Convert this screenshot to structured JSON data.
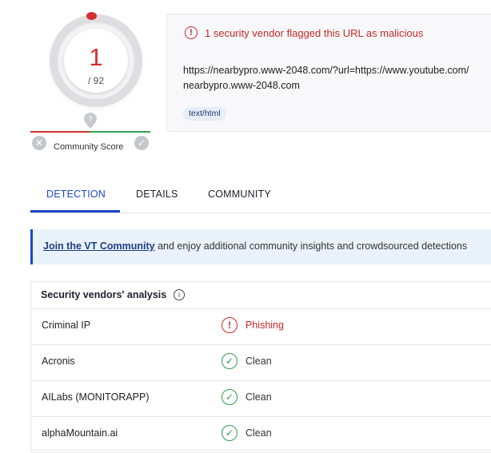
{
  "score": {
    "detections": "1",
    "total": "/ 92",
    "community_label": "Community Score"
  },
  "summary": {
    "alert": "1 security vendor flagged this URL as malicious",
    "url_full": "https://nearbypro.www-2048.com/?url=https://www.youtube.com/",
    "url_host": "nearbypro.www-2048.com",
    "tag": "text/html"
  },
  "tabs": [
    {
      "label": "DETECTION",
      "active": true
    },
    {
      "label": "DETAILS",
      "active": false
    },
    {
      "label": "COMMUNITY",
      "active": false
    }
  ],
  "banner": {
    "link": "Join the VT Community",
    "text": " and enjoy additional community insights and crowdsourced detections"
  },
  "analysis": {
    "title": "Security vendors' analysis",
    "rows": [
      {
        "vendor": "Criminal IP",
        "result": "Phishing",
        "status": "malicious"
      },
      {
        "vendor": "Acronis",
        "result": "Clean",
        "status": "clean"
      },
      {
        "vendor": "AILabs (MONITORAPP)",
        "result": "Clean",
        "status": "clean"
      },
      {
        "vendor": "alphaMountain.ai",
        "result": "Clean",
        "status": "clean"
      }
    ]
  },
  "colors": {
    "accent": "#1a47c6",
    "malicious": "#c62828",
    "clean": "#2e9d48"
  },
  "icons": {
    "alert": "exclamation-circle-icon",
    "info": "info-icon",
    "clean": "check-circle-icon",
    "malicious": "exclamation-circle-icon"
  }
}
